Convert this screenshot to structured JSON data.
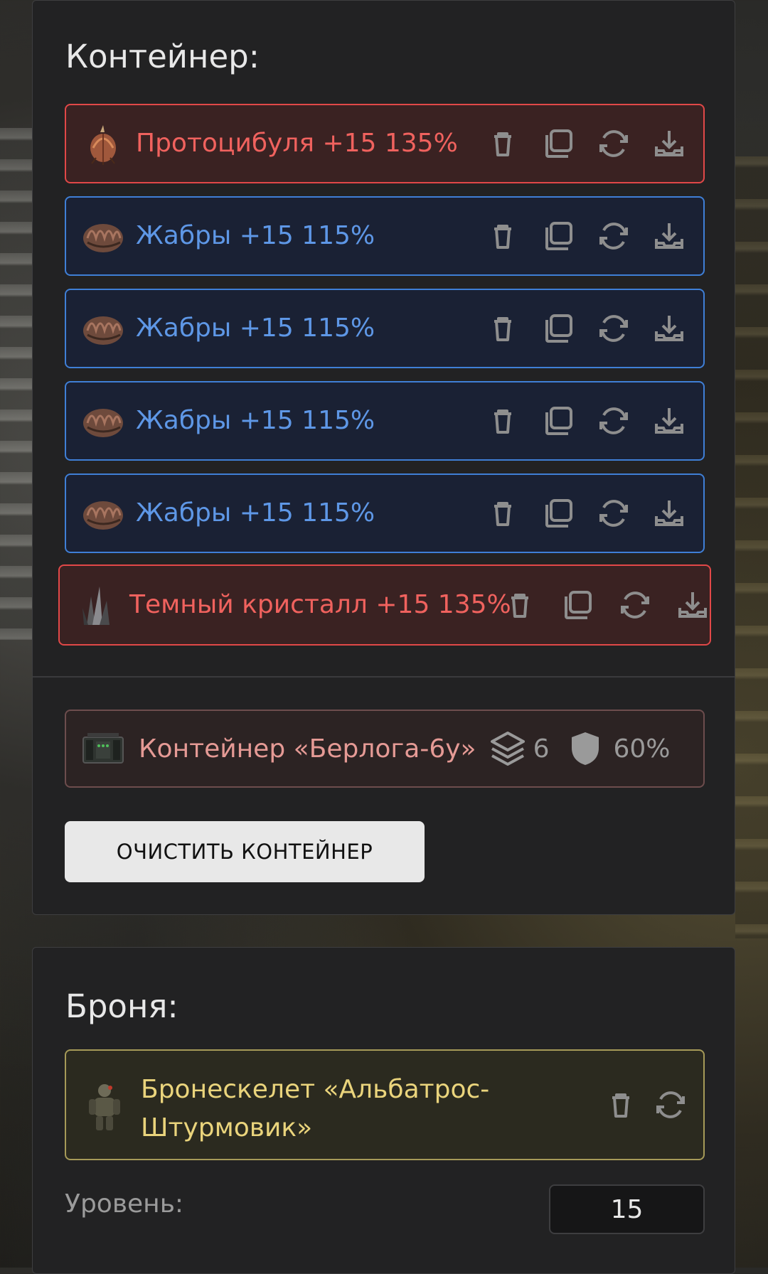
{
  "container_section": {
    "title": "Контейнер:",
    "items": [
      {
        "name": "Протоцибуля +15 135%",
        "rarity": "red",
        "icon": "onion-artifact-icon"
      },
      {
        "name": "Жабры +15 115%",
        "rarity": "blue",
        "icon": "gills-artifact-icon"
      },
      {
        "name": "Жабры +15 115%",
        "rarity": "blue",
        "icon": "gills-artifact-icon"
      },
      {
        "name": "Жабры +15 115%",
        "rarity": "blue",
        "icon": "gills-artifact-icon"
      },
      {
        "name": "Жабры +15 115%",
        "rarity": "blue",
        "icon": "gills-artifact-icon"
      },
      {
        "name": "Темный кристалл +15 135%",
        "rarity": "red",
        "icon": "dark-crystal-icon"
      }
    ],
    "item_actions": [
      "trash-icon",
      "copy-icon",
      "refresh-icon",
      "download-icon"
    ],
    "container": {
      "name": "Контейнер «Берлога-6у»",
      "slots": "6",
      "protection": "60%"
    },
    "clear_button": "ОЧИСТИТЬ КОНТЕЙНЕР"
  },
  "armor_section": {
    "title": "Броня:",
    "armor_name": "Бронескелет «Альбатрос-Штурмовик»",
    "level_label": "Уровень:",
    "level_value": "15"
  },
  "colors": {
    "red_border": "#e14848",
    "red_text": "#f0625e",
    "blue_border": "#3f7fd6",
    "blue_text": "#5e97e6",
    "armor_border": "#a69a58",
    "armor_text": "#ead47c"
  }
}
